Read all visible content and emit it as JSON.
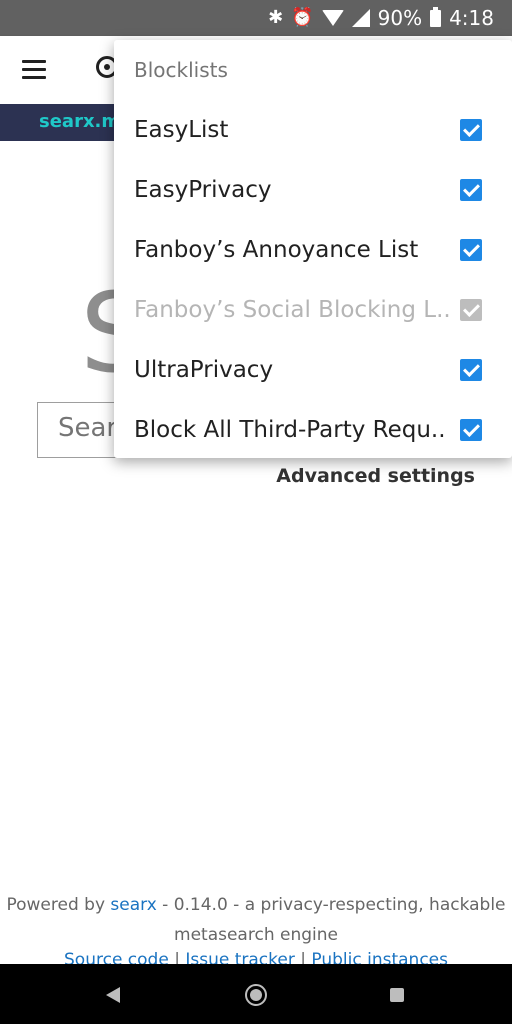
{
  "status_bar": {
    "battery": "90%",
    "time": "4:18",
    "icons": [
      "bluetooth-icon",
      "alarm-icon",
      "wifi-icon",
      "signal-icon",
      "battery-icon"
    ]
  },
  "banner": {
    "url": "searx.m"
  },
  "page": {
    "logo_letter": "S",
    "search_placeholder": "Sear",
    "advanced_settings": "Advanced settings"
  },
  "menu": {
    "title": "Blocklists",
    "items": [
      {
        "label": "EasyList",
        "checked": true,
        "enabled": true
      },
      {
        "label": "EasyPrivacy",
        "checked": true,
        "enabled": true
      },
      {
        "label": "Fanboy’s Annoyance List",
        "checked": true,
        "enabled": true
      },
      {
        "label": "Fanboy’s Social Blocking L..",
        "checked": true,
        "enabled": false
      },
      {
        "label": "UltraPrivacy",
        "checked": true,
        "enabled": true
      },
      {
        "label": "Block All Third-Party Requ..",
        "checked": true,
        "enabled": true
      }
    ]
  },
  "footer": {
    "powered_by": "Powered by ",
    "searx_link": "searx",
    "rest_line1": " - 0.14.0 - a privacy-respecting, hackable",
    "line2": "metasearch engine",
    "links": [
      "Source code",
      "Issue tracker",
      "Public instances"
    ],
    "separator": " | "
  },
  "colors": {
    "accent": "#1e88e5",
    "banner_bg": "#2c3252",
    "banner_text": "#1fc8c8",
    "link": "#1a73c1"
  }
}
